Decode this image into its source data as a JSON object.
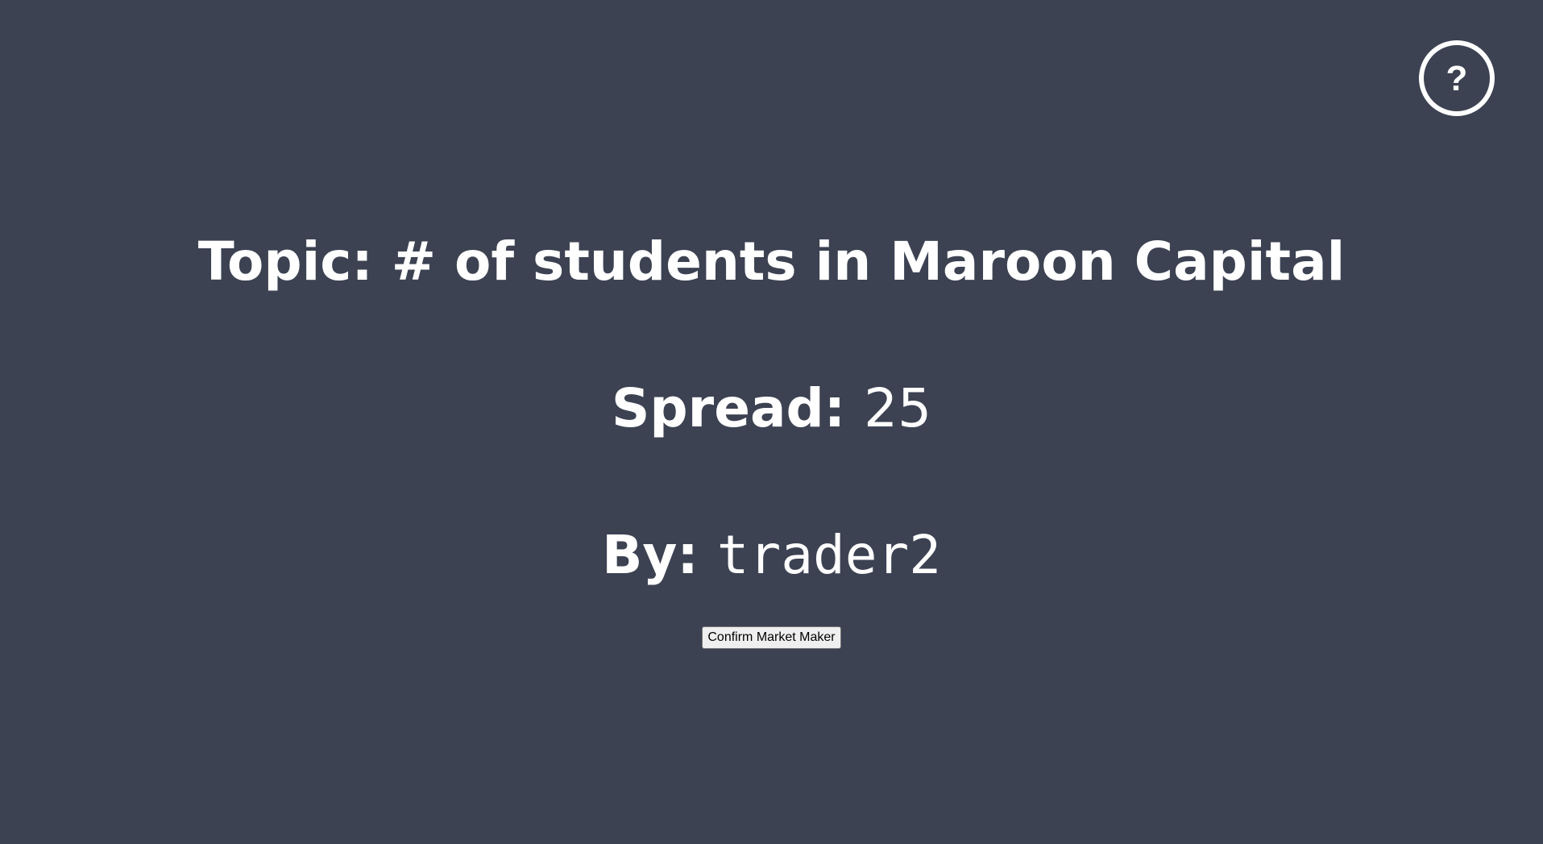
{
  "help": {
    "icon": "help-circle-icon",
    "glyph": "?"
  },
  "topic": {
    "label": "Topic:",
    "value": "# of students in Maroon Capital"
  },
  "spread": {
    "label": "Spread:",
    "value": "25"
  },
  "by": {
    "label": "By:",
    "value": "trader2"
  },
  "confirm_button": {
    "label": "Confirm Market Maker"
  },
  "colors": {
    "background": "#3c4252",
    "text": "#ffffff"
  }
}
